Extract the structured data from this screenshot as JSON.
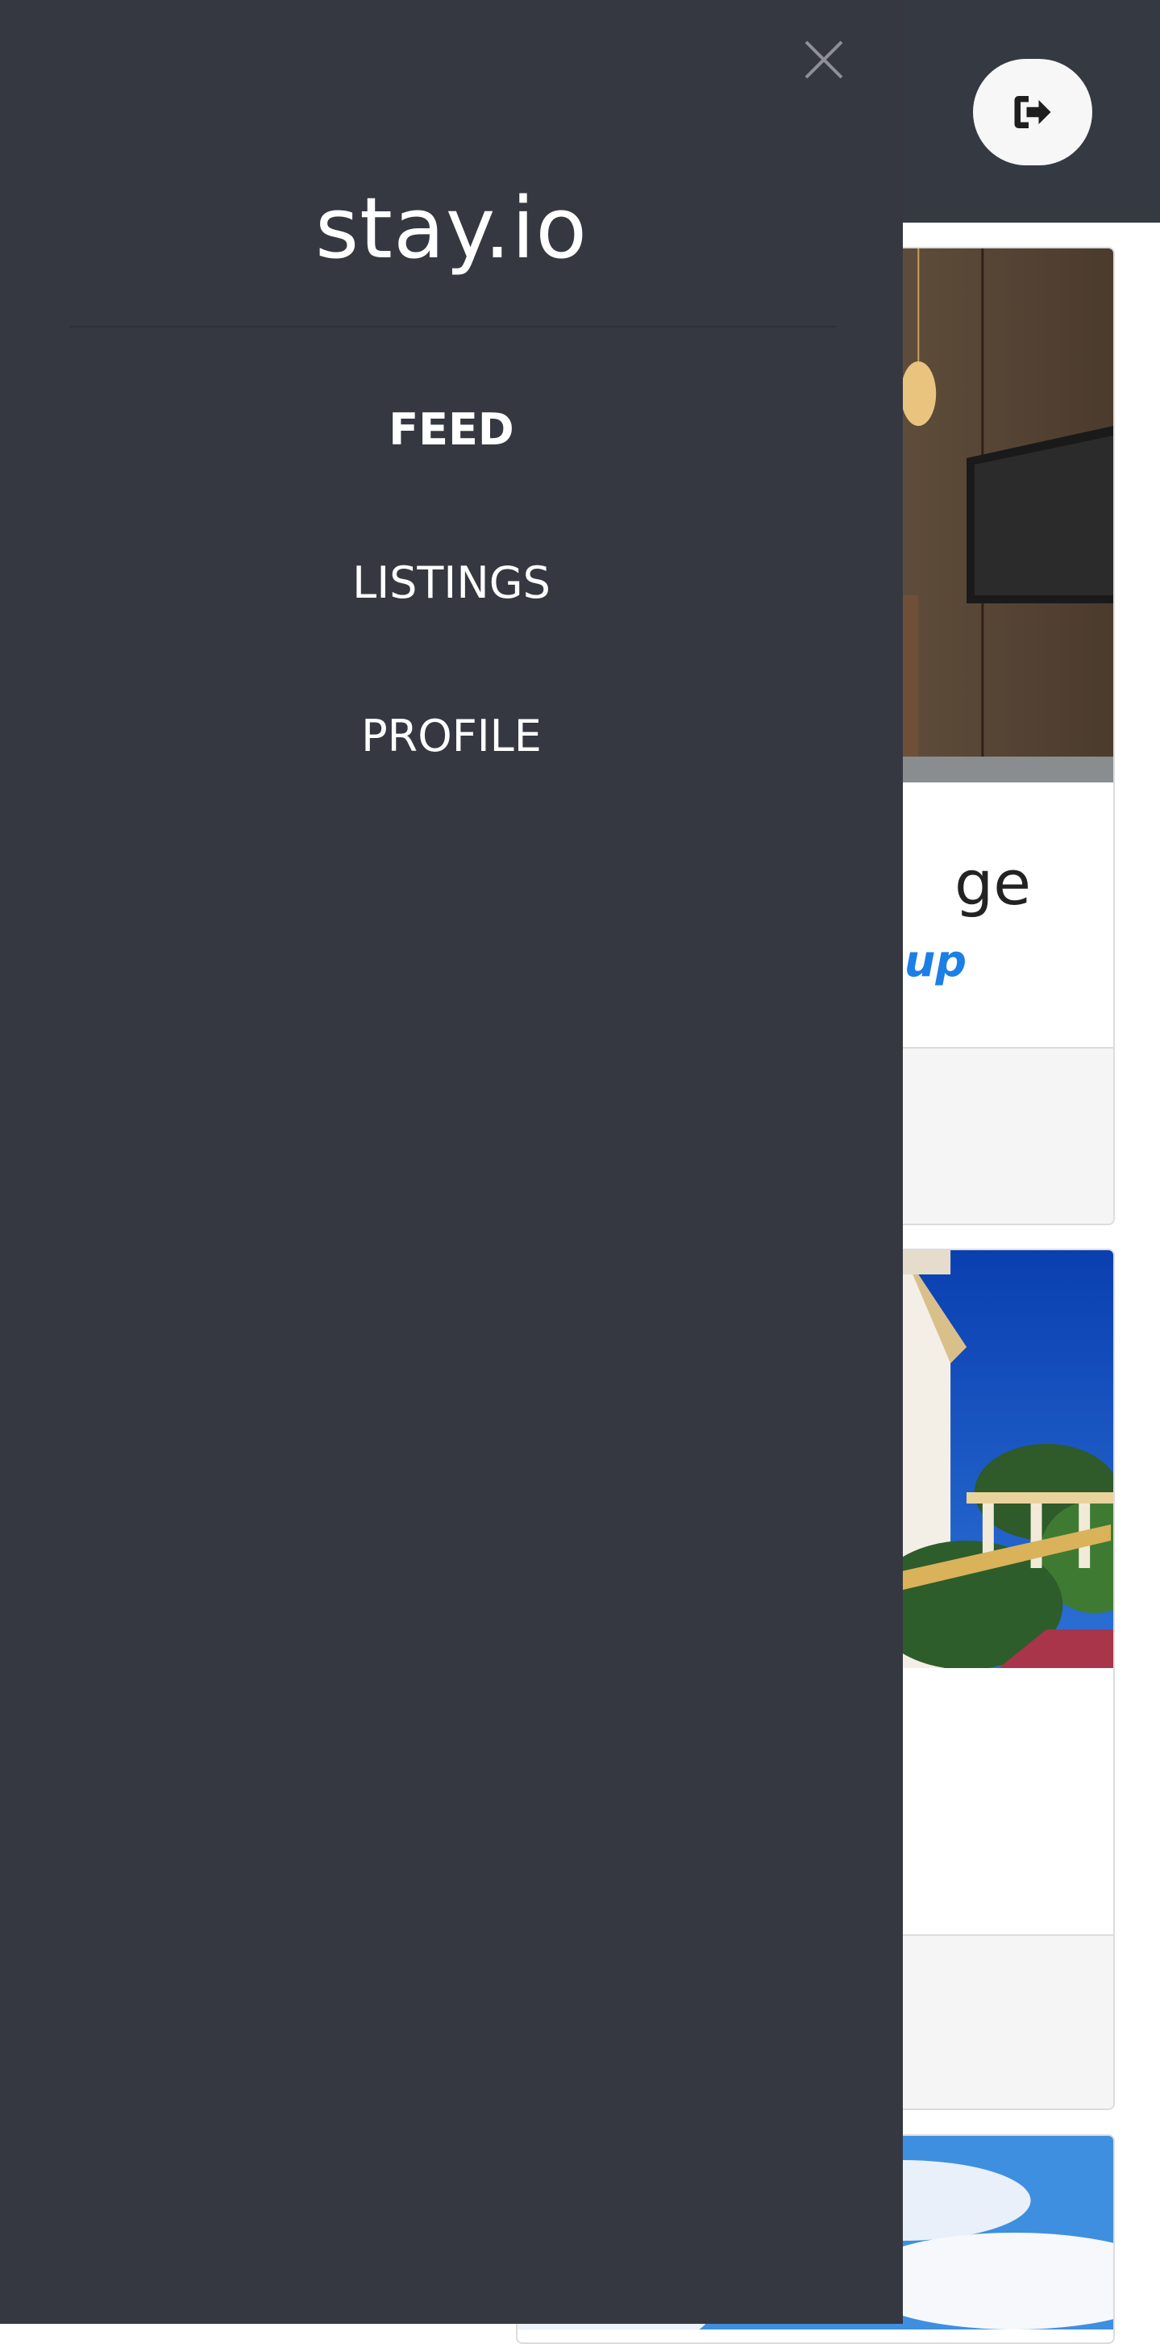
{
  "app": {
    "brand": "stay.io"
  },
  "drawer": {
    "close_icon": "close-icon",
    "nav_items": [
      {
        "label": "FEED",
        "active": true
      },
      {
        "label": "LISTINGS",
        "active": false
      },
      {
        "label": "PROFILE",
        "active": false
      }
    ]
  },
  "header": {
    "logout_icon": "logout-icon"
  },
  "feed": {
    "cards": [
      {
        "title_fragment": "ge",
        "subtitle_fragment": "oup",
        "photo": "hotel-room-photo"
      },
      {
        "photo": "building-exterior-photo"
      },
      {
        "photo": "sky-clouds-photo"
      }
    ]
  },
  "colors": {
    "drawer_bg": "#353841",
    "topbar_bg": "#353941",
    "accent": "#1b7fe6"
  }
}
